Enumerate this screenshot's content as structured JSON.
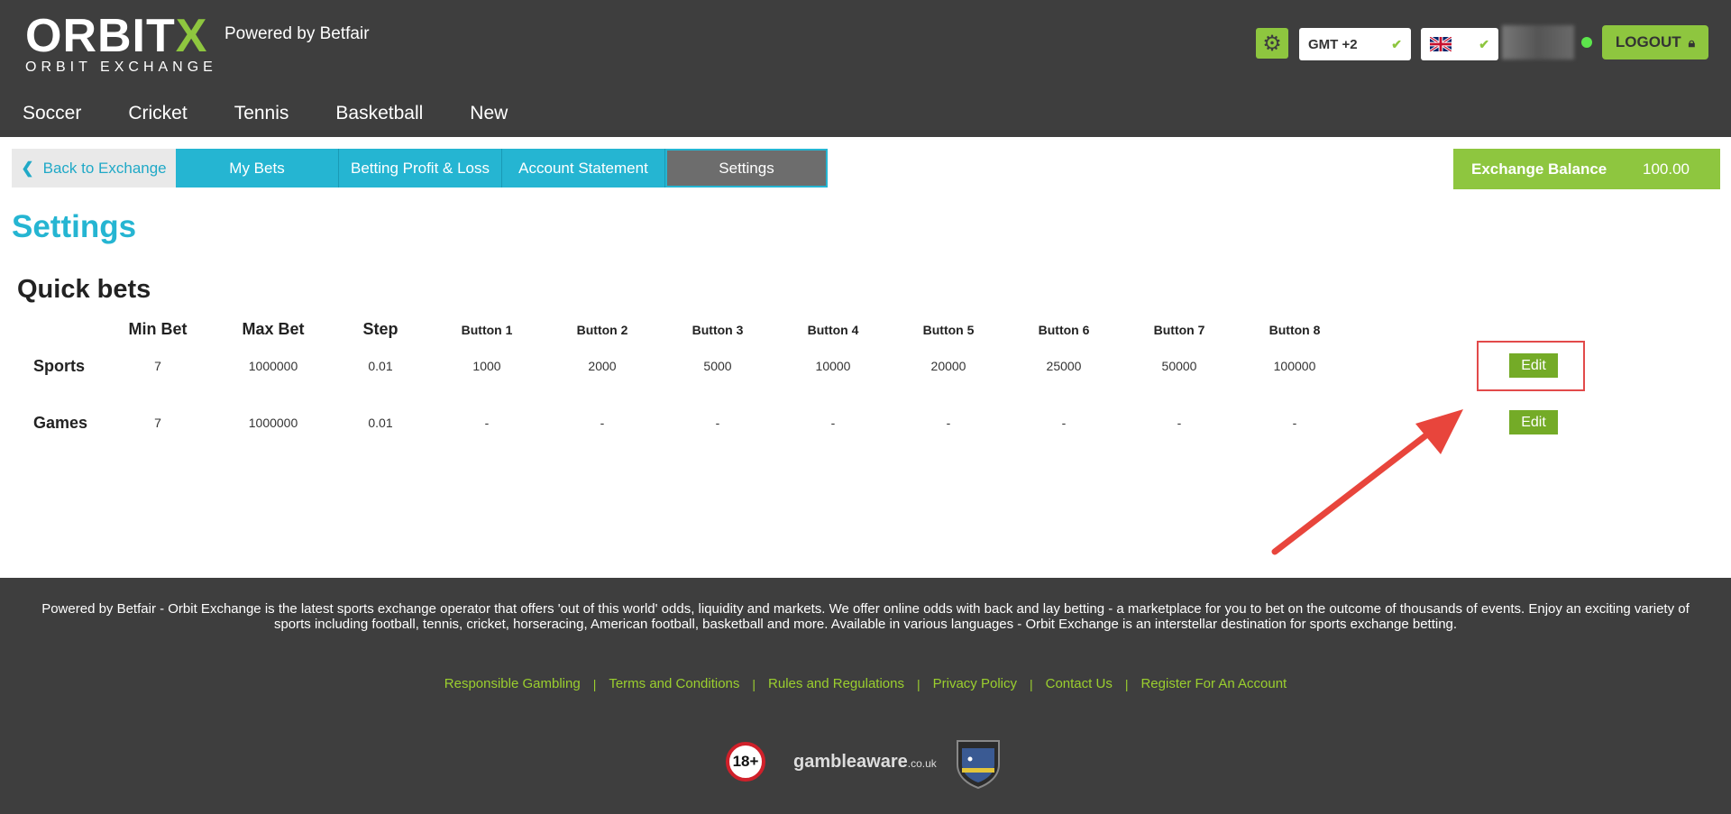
{
  "header": {
    "logo_main": "ORBIT",
    "logo_x": "X",
    "logo_sub": "ORBIT EXCHANGE",
    "powered_by": "Powered by Betfair",
    "timezone": "GMT +2",
    "logout": "LOGOUT",
    "accent": "#8ec63f"
  },
  "nav": [
    "Soccer",
    "Cricket",
    "Tennis",
    "Basketball",
    "New"
  ],
  "tabs": {
    "back": "Back to Exchange",
    "items": [
      "My Bets",
      "Betting Profit & Loss",
      "Account Statement",
      "Settings"
    ]
  },
  "balance": {
    "label": "Exchange Balance",
    "value": "100.00"
  },
  "page_title": "Settings",
  "quick_bets": {
    "title": "Quick bets",
    "headers": [
      "Min Bet",
      "Max Bet",
      "Step",
      "Button 1",
      "Button 2",
      "Button 3",
      "Button 4",
      "Button 5",
      "Button 6",
      "Button 7",
      "Button 8"
    ],
    "rows": [
      {
        "label": "Sports",
        "values": [
          "7",
          "1000000",
          "0.01",
          "1000",
          "2000",
          "5000",
          "10000",
          "20000",
          "25000",
          "50000",
          "100000"
        ],
        "action": "Edit"
      },
      {
        "label": "Games",
        "values": [
          "7",
          "1000000",
          "0.01",
          "-",
          "-",
          "-",
          "-",
          "-",
          "-",
          "-",
          "-"
        ],
        "action": "Edit"
      }
    ]
  },
  "footer": {
    "text": "Powered by Betfair - Orbit Exchange is the latest sports exchange operator that offers 'out of this world' odds, liquidity and markets. We offer online odds with back and lay betting - a marketplace for you to bet on the outcome of thousands of events. Enjoy an exciting variety of sports including football, tennis, cricket, horseracing, American football, basketball and more. Available in various languages - Orbit Exchange is an interstellar destination for sports exchange betting.",
    "links": [
      "Responsible Gambling",
      "Terms and Conditions",
      "Rules and Regulations",
      "Privacy Policy",
      "Contact Us",
      "Register For An Account"
    ],
    "age": "18+",
    "gambleaware": "gambleaware",
    "gambleaware_tld": ".co.uk"
  }
}
